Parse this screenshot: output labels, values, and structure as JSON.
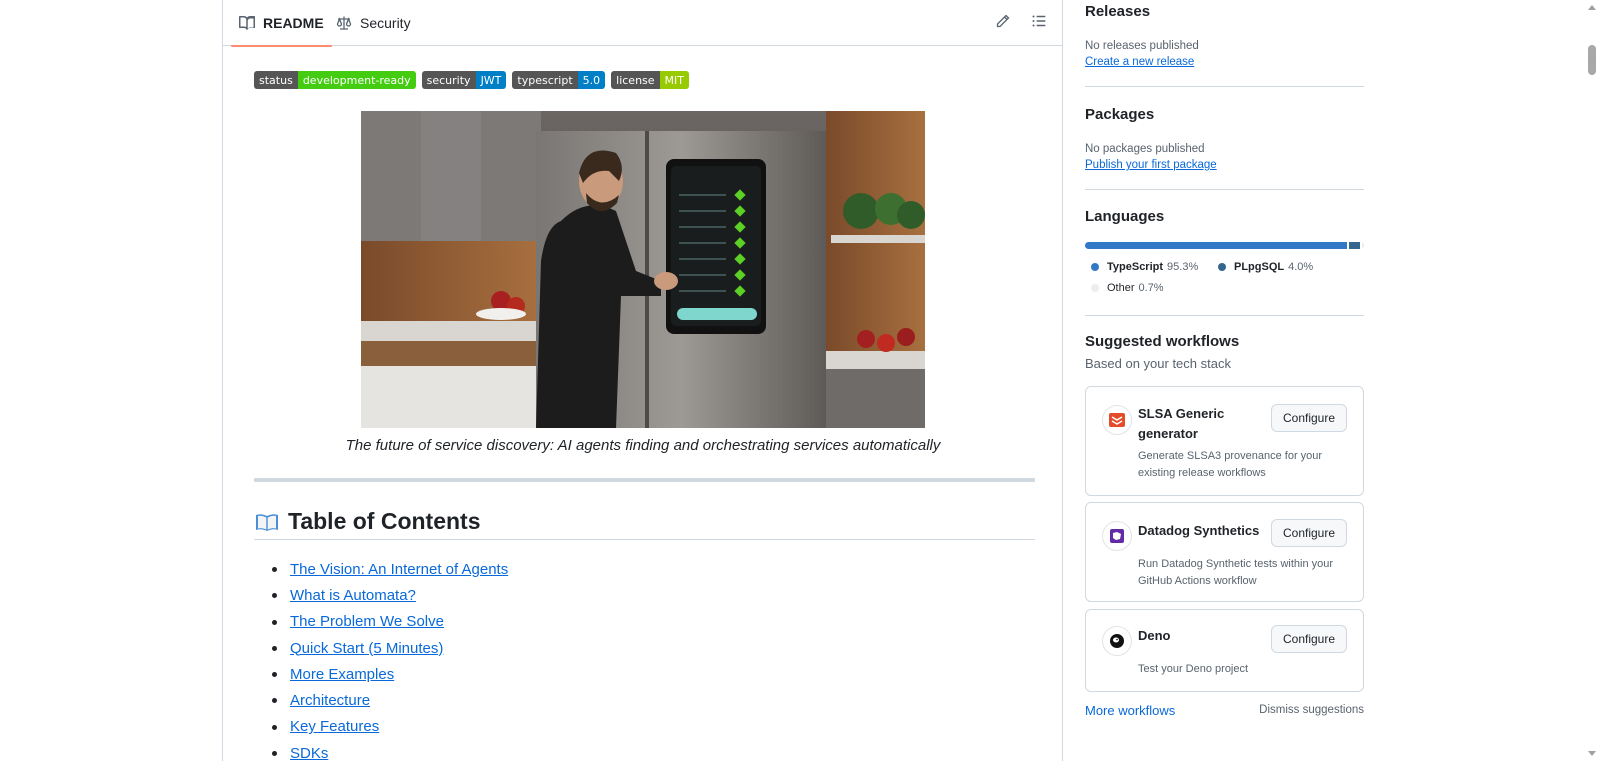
{
  "readme": {
    "tabs": [
      {
        "label": "README",
        "icon": "book-icon",
        "active": true
      },
      {
        "label": "Security",
        "icon": "law-scale-icon",
        "active": false
      }
    ],
    "toolbar_icons": [
      "pencil-icon",
      "list-unordered-icon"
    ],
    "badges": [
      {
        "key": "status",
        "value": "development-ready",
        "color": "#4c1"
      },
      {
        "key": "security",
        "value": "JWT",
        "color": "#007ec6"
      },
      {
        "key": "typescript",
        "value": "5.0",
        "color": "#007ec6"
      },
      {
        "key": "license",
        "value": "MIT",
        "color": "#97ca00"
      }
    ],
    "caption": "The future of service discovery: AI agents finding and orchestrating services automatically",
    "toc_title": "Table of Contents",
    "toc_icon": "open-book-emoji",
    "toc": [
      "The Vision: An Internet of Agents",
      "What is Automata?",
      "The Problem We Solve",
      "Quick Start (5 Minutes)",
      "More Examples",
      "Architecture",
      "Key Features",
      "SDKs"
    ]
  },
  "sidebar": {
    "releases": {
      "title": "Releases",
      "empty_text": "No releases published",
      "link": "Create a new release"
    },
    "packages": {
      "title": "Packages",
      "empty_text": "No packages published",
      "link": "Publish your first package"
    },
    "languages": {
      "title": "Languages",
      "items": [
        {
          "name": "TypeScript",
          "pct": "95.3%",
          "value": 95.3,
          "color": "#3178c6"
        },
        {
          "name": "PLpgSQL",
          "pct": "4.0%",
          "value": 4.0,
          "color": "#336790"
        },
        {
          "name": "Other",
          "pct": "0.7%",
          "value": 0.7,
          "color": "#ededed"
        }
      ]
    },
    "workflows": {
      "title": "Suggested workflows",
      "subtitle": "Based on your tech stack",
      "items": [
        {
          "name": "SLSA Generic generator",
          "description": "Generate SLSA3 provenance for your existing release workflows",
          "button": "Configure",
          "icon": "slsa-logo-icon"
        },
        {
          "name": "Datadog Synthetics",
          "description": "Run Datadog Synthetic tests within your GitHub Actions workflow",
          "button": "Configure",
          "icon": "datadog-logo-icon"
        },
        {
          "name": "Deno",
          "description": "Test your Deno project",
          "button": "Configure",
          "icon": "deno-logo-icon"
        }
      ],
      "more_link": "More workflows",
      "dismiss": "Dismiss suggestions"
    }
  }
}
